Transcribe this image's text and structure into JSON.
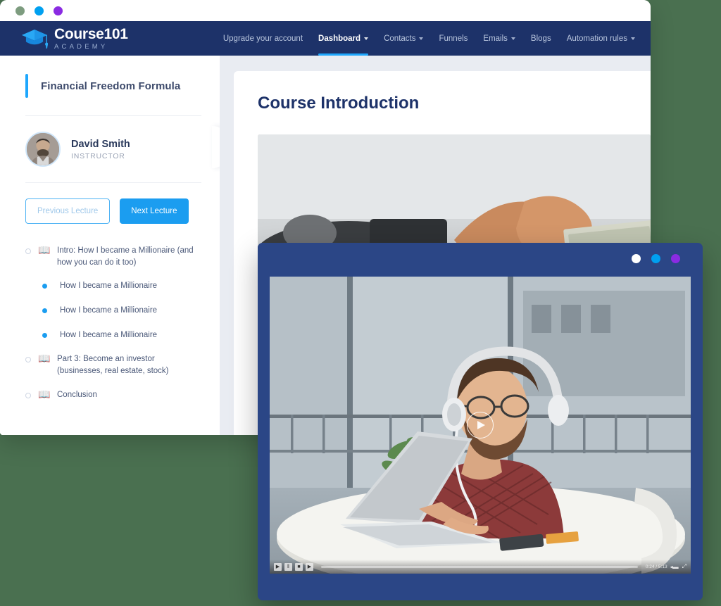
{
  "window": {
    "dots": [
      "green",
      "blue",
      "purple"
    ]
  },
  "nav": {
    "logo": {
      "name": "Course101",
      "sub": "ACADEMY",
      "icon": "graduation-cap-icon"
    },
    "items": [
      {
        "label": "Upgrade your account",
        "caret": false,
        "active": false
      },
      {
        "label": "Dashboard",
        "caret": true,
        "active": true
      },
      {
        "label": "Contacts",
        "caret": true,
        "active": false
      },
      {
        "label": "Funnels",
        "caret": false,
        "active": false
      },
      {
        "label": "Emails",
        "caret": true,
        "active": false
      },
      {
        "label": "Blogs",
        "caret": false,
        "active": false
      },
      {
        "label": "Automation rules",
        "caret": true,
        "active": false
      }
    ],
    "active_color": "#1ea7fd",
    "bar_color": "#1d3269"
  },
  "sidebar": {
    "course_title": "Financial Freedom Formula",
    "instructor": {
      "name": "David Smith",
      "role": "INSTRUCTOR",
      "avatar": "avatar-photo"
    },
    "buttons": {
      "previous": "Previous Lecture",
      "next": "Next Lecture"
    },
    "collapse_icon": "‹",
    "lectures": [
      {
        "type": "chapter",
        "icon": "book-icon",
        "text": "Intro: How I became a Millionaire (and how you can do it too)"
      },
      {
        "type": "lesson",
        "icon": "bullet-icon",
        "text": "How I became a Millionaire"
      },
      {
        "type": "lesson",
        "icon": "bullet-icon",
        "text": "How I became a Millionaire"
      },
      {
        "type": "lesson",
        "icon": "bullet-icon",
        "text": "How I became a Millionaire"
      },
      {
        "type": "chapter",
        "icon": "book-icon",
        "text": "Part 3: Become an investor (businesses, real estate, stock)"
      },
      {
        "type": "chapter",
        "icon": "book-icon",
        "text": "Conclusion"
      }
    ]
  },
  "main": {
    "page_title": "Course Introduction",
    "hero_alt": "hands-exchanging-money-photo"
  },
  "video_window": {
    "dots": [
      "white",
      "blue",
      "purple"
    ],
    "poster_alt": "man-with-headphones-at-laptop-photo",
    "play_label": "play-button",
    "controls": {
      "play": "▶",
      "pause": "‖",
      "stop": "■",
      "next": "▶",
      "time": "0:24 / 5:13",
      "volume": "◂▬",
      "fullscreen": "⤢"
    }
  }
}
